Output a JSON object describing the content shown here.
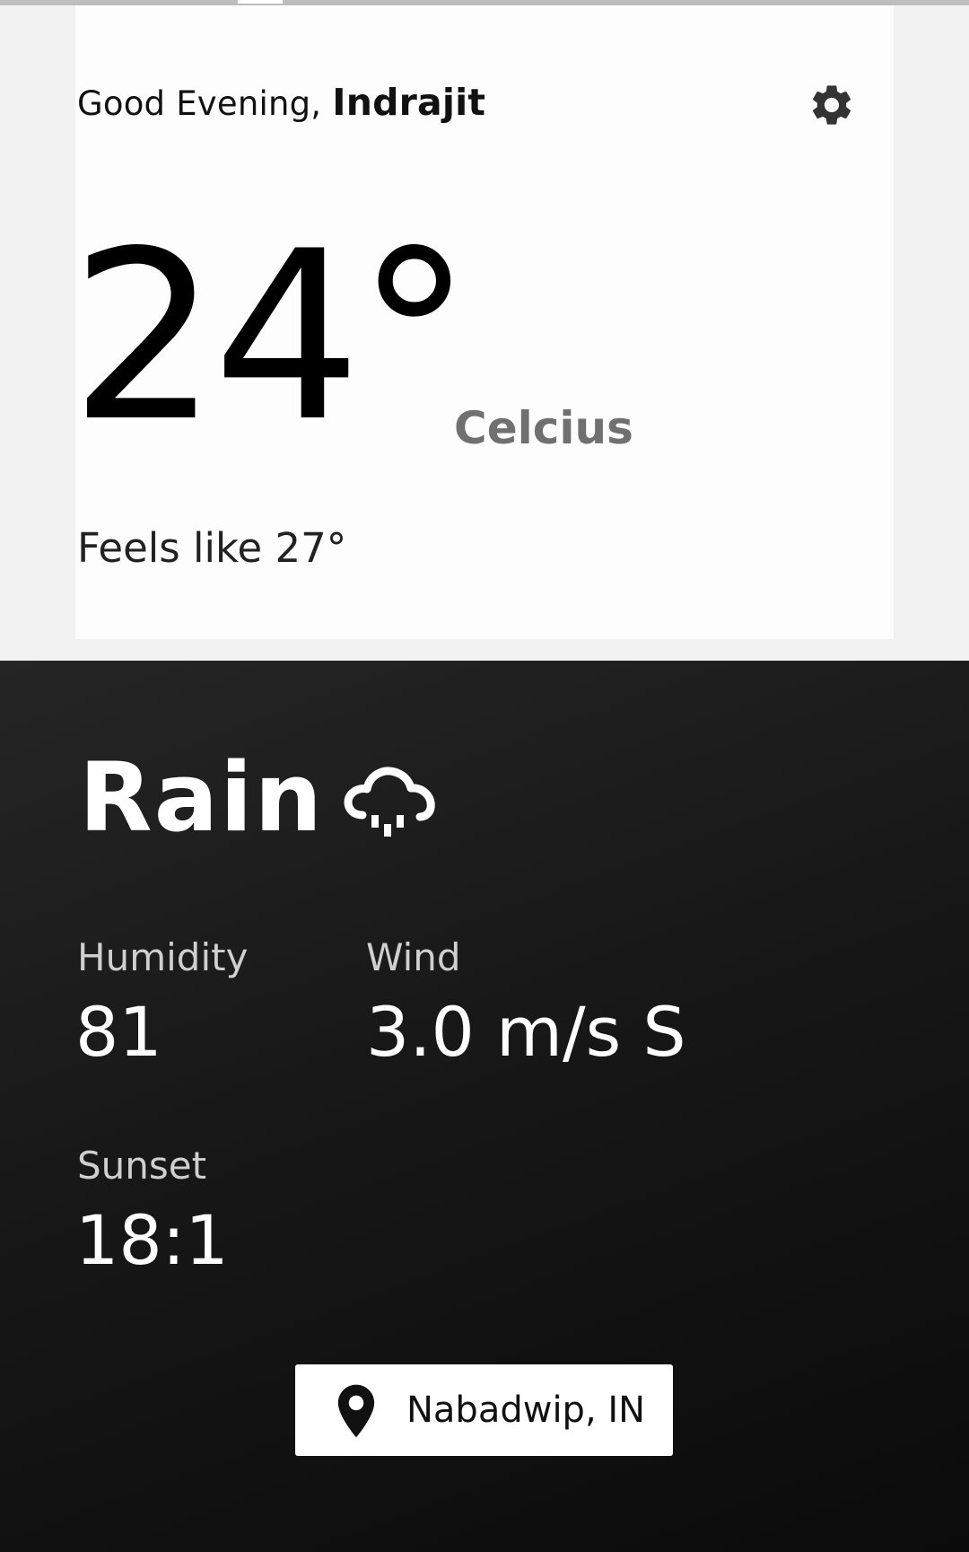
{
  "header": {
    "greeting": "Good Evening, ",
    "user_name": "Indrajit",
    "settings_icon": "gear-icon"
  },
  "current": {
    "temperature": "24°",
    "unit": "Celcius",
    "feels_like": "Feels like 27°"
  },
  "details": {
    "condition": "Rain",
    "condition_icon": "rain-cloud-icon",
    "humidity": {
      "label": "Humidity",
      "value": "81"
    },
    "wind": {
      "label": "Wind",
      "value": "3.0 m/s S"
    },
    "sunset": {
      "label": "Sunset",
      "value": "18:1"
    }
  },
  "location": {
    "icon": "location-pin-icon",
    "label": "Nabadwip, IN"
  },
  "colors": {
    "top_background": "#fdfdfd",
    "bottom_background": "#161616",
    "unit_text": "#707070",
    "detail_label": "#cfcfcf"
  }
}
